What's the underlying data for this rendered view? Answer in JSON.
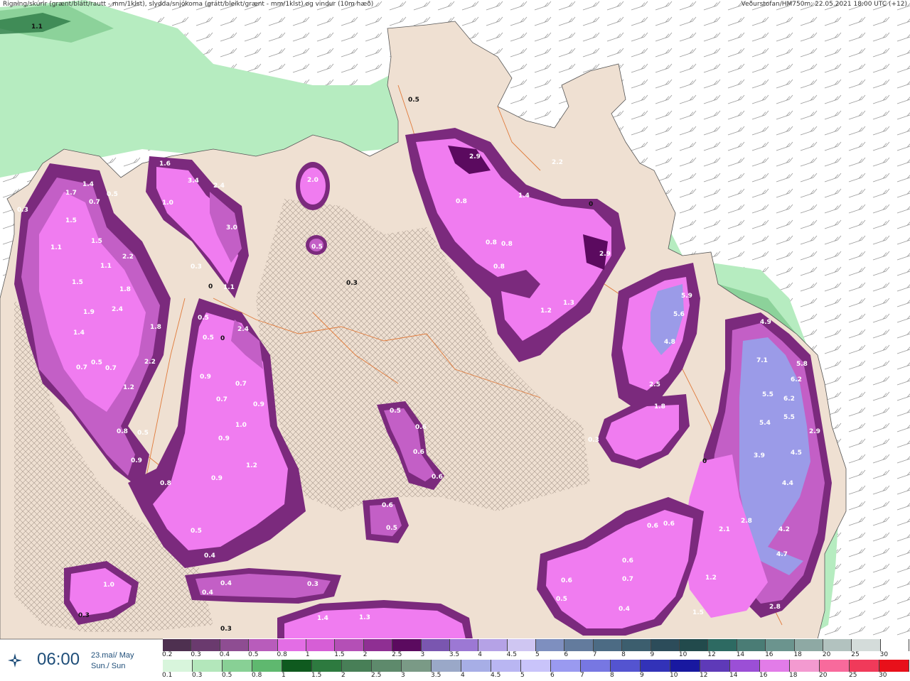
{
  "header": {
    "title_left": "Rigning/skúrir (grænt/blátt/rautt - mm/1klst), slydda/snjókoma (grátt/bleikt/grænt - mm/1klst) og vindur (10m hæð)",
    "title_right": "Veðurstofan/HM750m: 22.05.2021 18:00 UTC (+12)"
  },
  "time_panel": {
    "icon": "compass-star-icon",
    "time": "06:00",
    "date_line1": "23.maí/ May",
    "date_line2": "Sun./ Sun"
  },
  "colors": {
    "land": "#efe0d2",
    "snow_light": "#f07cf0",
    "snow_mid": "#c35fc6",
    "snow_dark": "#7b2a7d",
    "snow_blue": "#9b9be8",
    "rain_light": "#b6ecc0",
    "rain_mid": "#6abd7a",
    "rain_dark": "#1f6e3a",
    "road": "#e07a3a"
  },
  "legend": {
    "snow_labels": [
      "0.2",
      "0.3",
      "0.4",
      "0.5",
      "0.8",
      "1",
      "1.5",
      "2",
      "2.5",
      "3",
      "3.5",
      "4",
      "4.5",
      "5",
      "6",
      "7",
      "8",
      "9",
      "10",
      "12",
      "14",
      "16",
      "18",
      "20",
      "25",
      "30"
    ],
    "snow_colors": [
      "#4e3050",
      "#6a3a6e",
      "#8e4d92",
      "#b85cbb",
      "#e36de5",
      "#d65ed6",
      "#b44fb6",
      "#8f2f93",
      "#5b0a5f",
      "#7a56b0",
      "#9c78d4",
      "#b5a2e6",
      "#cfc6f2",
      "#7e8fbf",
      "#637b9d",
      "#4c6b84",
      "#3c5e6e",
      "#2c4c5a",
      "#224a4c",
      "#2d6a62",
      "#4a7c75",
      "#6b948e",
      "#8ea9a4",
      "#b2c2bf",
      "#d4dcda",
      "#ffffff"
    ],
    "rain_labels": [
      "0.1",
      "0.3",
      "0.5",
      "0.8",
      "1",
      "1.5",
      "2",
      "2.5",
      "3",
      "3.5",
      "4",
      "4.5",
      "5",
      "6",
      "7",
      "8",
      "9",
      "10",
      "12",
      "14",
      "16",
      "18",
      "20",
      "25",
      "30"
    ],
    "rain_colors": [
      "#d8f5dc",
      "#b3e7bb",
      "#88d095",
      "#5fb86f",
      "#0f5a1f",
      "#2d7a3f",
      "#487f57",
      "#5e8a6c",
      "#7a9a86",
      "#9aa8c8",
      "#a7aee6",
      "#b9b6f2",
      "#c9c4fa",
      "#9a9af0",
      "#7777e2",
      "#5454d0",
      "#3232b8",
      "#1818a0",
      "#5e3ab8",
      "#9b4fd6",
      "#e27ce8",
      "#f39ad0",
      "#f86a9c",
      "#f03a5a",
      "#e8101a"
    ]
  },
  "map_labels": [
    {
      "text": "1.1"
    },
    {
      "text": "0.5"
    },
    {
      "text": "2.9"
    },
    {
      "text": "2.2"
    },
    {
      "text": "0.8"
    },
    {
      "text": "1.4"
    },
    {
      "text": "0"
    },
    {
      "text": "2.9"
    },
    {
      "text": "0.8"
    },
    {
      "text": "0.8"
    },
    {
      "text": "0.8"
    },
    {
      "text": "1.2"
    },
    {
      "text": "1.3"
    },
    {
      "text": "2.0"
    },
    {
      "text": "0.5"
    },
    {
      "text": "0.3"
    },
    {
      "text": "1.6"
    },
    {
      "text": "1.0"
    },
    {
      "text": "3.4"
    },
    {
      "text": "2.4"
    },
    {
      "text": "3.0"
    },
    {
      "text": "0.3"
    },
    {
      "text": "1.1"
    },
    {
      "text": "0"
    },
    {
      "text": "1.7"
    },
    {
      "text": "1.4"
    },
    {
      "text": "0.5"
    },
    {
      "text": "0.7"
    },
    {
      "text": "0.3"
    },
    {
      "text": "1.5"
    },
    {
      "text": "1.1"
    },
    {
      "text": "1.5"
    },
    {
      "text": "2.2"
    },
    {
      "text": "1.1"
    },
    {
      "text": "1.5"
    },
    {
      "text": "1.8"
    },
    {
      "text": "1.9"
    },
    {
      "text": "2.4"
    },
    {
      "text": "1.4"
    },
    {
      "text": "1.8"
    },
    {
      "text": "0.7"
    },
    {
      "text": "0.5"
    },
    {
      "text": "0.7"
    },
    {
      "text": "2.2"
    },
    {
      "text": "1.2"
    },
    {
      "text": "0.8"
    },
    {
      "text": "0.5"
    },
    {
      "text": "0.9"
    },
    {
      "text": "0.8"
    },
    {
      "text": "0.5"
    },
    {
      "text": "0.5"
    },
    {
      "text": "0"
    },
    {
      "text": "2.4"
    },
    {
      "text": "0.9"
    },
    {
      "text": "0.7"
    },
    {
      "text": "0.7"
    },
    {
      "text": "0.9"
    },
    {
      "text": "1.0"
    },
    {
      "text": "0.9"
    },
    {
      "text": "1.2"
    },
    {
      "text": "0.9"
    },
    {
      "text": "0.5"
    },
    {
      "text": "0.4"
    },
    {
      "text": "0.5"
    },
    {
      "text": "0.6"
    },
    {
      "text": "0.6"
    },
    {
      "text": "0.6"
    },
    {
      "text": "0.6"
    },
    {
      "text": "0.5"
    },
    {
      "text": "5.9"
    },
    {
      "text": "5.6"
    },
    {
      "text": "4.8"
    },
    {
      "text": "2.5"
    },
    {
      "text": "1.8"
    },
    {
      "text": "0.3"
    },
    {
      "text": "0"
    },
    {
      "text": "4.9"
    },
    {
      "text": "7.1"
    },
    {
      "text": "5.8"
    },
    {
      "text": "6.2"
    },
    {
      "text": "5.5"
    },
    {
      "text": "6.2"
    },
    {
      "text": "5.5"
    },
    {
      "text": "5.4"
    },
    {
      "text": "2.9"
    },
    {
      "text": "3.9"
    },
    {
      "text": "4.5"
    },
    {
      "text": "4.4"
    },
    {
      "text": "2.8"
    },
    {
      "text": "4.2"
    },
    {
      "text": "4.7"
    },
    {
      "text": "2.1"
    },
    {
      "text": "0.6"
    },
    {
      "text": "0.6"
    },
    {
      "text": "0.6"
    },
    {
      "text": "0.7"
    },
    {
      "text": "0.6"
    },
    {
      "text": "0.5"
    },
    {
      "text": "0.4"
    },
    {
      "text": "1.2"
    },
    {
      "text": "1.5"
    },
    {
      "text": "2.8"
    },
    {
      "text": "1.0"
    },
    {
      "text": "0.3"
    },
    {
      "text": "0.4"
    },
    {
      "text": "0.3"
    },
    {
      "text": "0.4"
    },
    {
      "text": "0.3"
    },
    {
      "text": "1.4"
    },
    {
      "text": "1.3"
    }
  ]
}
